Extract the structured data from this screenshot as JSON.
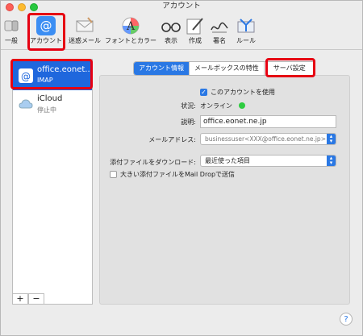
{
  "window": {
    "title": "アカウント"
  },
  "toolbar": {
    "items": [
      {
        "label": "一般",
        "icon": "switch-icon"
      },
      {
        "label": "アカウント",
        "icon": "at-icon"
      },
      {
        "label": "迷惑メール",
        "icon": "junk-mail-icon"
      },
      {
        "label": "フォントとカラー",
        "icon": "font-color-icon"
      },
      {
        "label": "表示",
        "icon": "glasses-icon"
      },
      {
        "label": "作成",
        "icon": "compose-icon"
      },
      {
        "label": "署名",
        "icon": "signature-icon"
      },
      {
        "label": "ルール",
        "icon": "rules-icon"
      }
    ]
  },
  "sidebar": {
    "accounts": [
      {
        "name": "office.eonet...",
        "type": "IMAP",
        "icon": "at-icon"
      },
      {
        "name": "iCloud",
        "type": "停止中",
        "icon": "cloud-icon"
      }
    ],
    "add_label": "+",
    "remove_label": "−"
  },
  "tabs": [
    {
      "label": "アカウント情報"
    },
    {
      "label": "メールボックスの特性"
    },
    {
      "label": "サーバ設定"
    }
  ],
  "form": {
    "enable_label": "このアカウントを使用",
    "status_label": "状況:",
    "status_value": "オンライン",
    "status_color": "#2ecc40",
    "description_label": "説明:",
    "description_value": "office.eonet.ne.jp",
    "email_label": "メールアドレス:",
    "email_value": "businessuser<XXX@office.eonet.ne.jp>",
    "attachments_label": "添付ファイルをダウンロード:",
    "attachments_value": "最近使った項目",
    "maildrop_label": "大きい添付ファイルをMail Dropで送信"
  },
  "help_label": "?",
  "colors": {
    "accent": "#2a78e4",
    "highlight_box": "#e60012",
    "selection": "#1f67dd"
  }
}
